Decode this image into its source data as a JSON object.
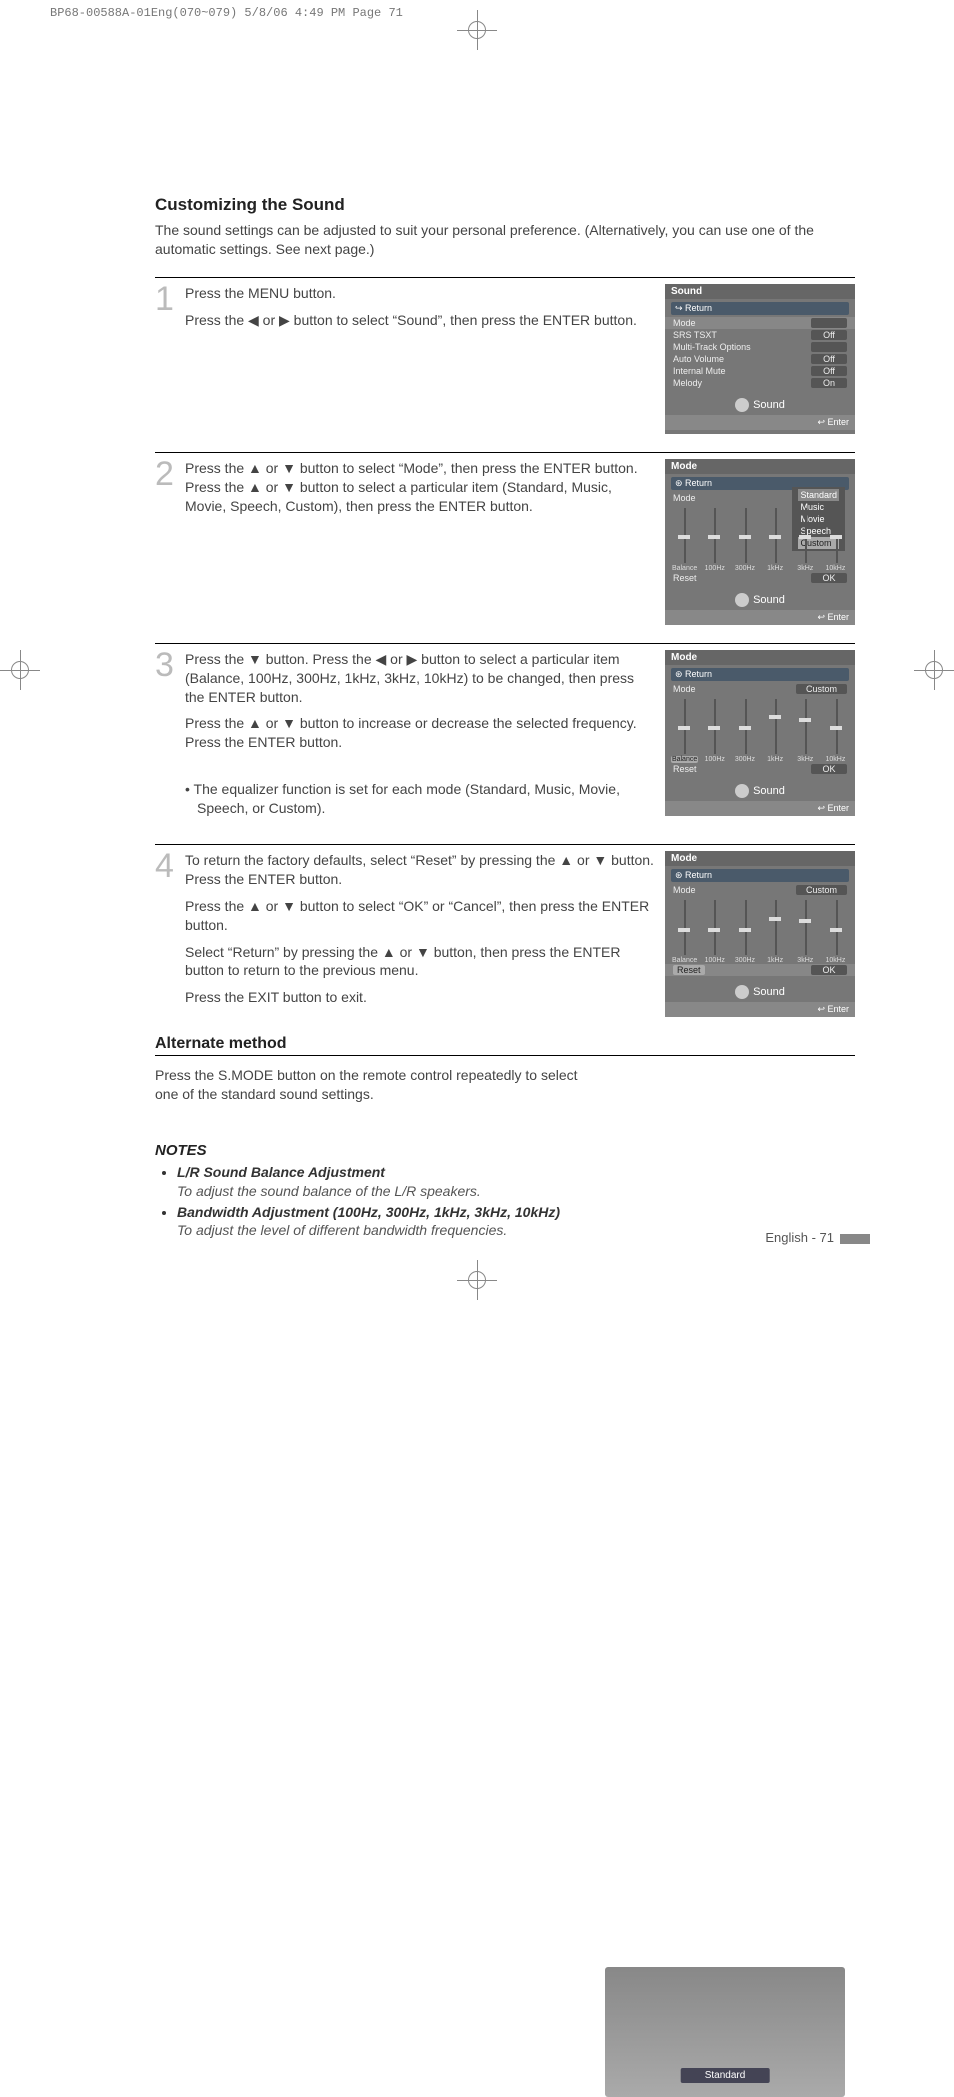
{
  "crop_header": "BP68-00588A-01Eng(070~079)  5/8/06  4:49 PM  Page 71",
  "title": "Customizing the Sound",
  "intro": "The sound settings can be adjusted to suit your personal preference. (Alternatively, you can use one of the automatic settings. See next page.)",
  "steps": [
    {
      "num": "1",
      "paras": [
        "Press the MENU button.",
        "Press the ◀ or ▶ button to select “Sound”, then press the ENTER button."
      ],
      "bullet": ""
    },
    {
      "num": "2",
      "paras": [
        "Press the ▲ or ▼ button to select “Mode”, then press the ENTER button. Press the ▲ or ▼ button to select a particular item (Standard, Music, Movie, Speech, Custom), then press the ENTER button."
      ],
      "bullet": ""
    },
    {
      "num": "3",
      "paras": [
        "Press the ▼ button. Press the ◀ or ▶ button to select a particular item (Balance, 100Hz, 300Hz, 1kHz, 3kHz, 10kHz) to be changed, then press the ENTER button.",
        "Press the ▲ or ▼ button to increase or decrease the selected frequency. Press the ENTER button."
      ],
      "bullet": "• The equalizer function is set for each mode (Standard, Music, Movie, Speech, or Custom)."
    },
    {
      "num": "4",
      "paras": [
        "To return the factory defaults, select “Reset” by pressing the ▲ or ▼ button. Press the ENTER button.",
        "Press the ▲ or ▼ button to select “OK” or “Cancel”, then press the ENTER button.",
        "Select “Return” by pressing the ▲ or ▼ button, then press the ENTER button to return to the previous menu.",
        "Press the EXIT button to exit."
      ],
      "bullet": ""
    }
  ],
  "screenshot1": {
    "title": "Sound",
    "return": "↪ Return",
    "rows": [
      {
        "label": "Mode",
        "val": ""
      },
      {
        "label": "SRS TSXT",
        "val": "Off"
      },
      {
        "label": "Multi-Track Options",
        "val": ""
      },
      {
        "label": "Auto Volume",
        "val": "Off"
      },
      {
        "label": "Internal Mute",
        "val": "Off"
      },
      {
        "label": "Melody",
        "val": "On"
      }
    ],
    "footer_label": "Sound",
    "footer_enter": "↩ Enter"
  },
  "screenshot2": {
    "title": "Mode",
    "return": "⊛ Return",
    "mode_label": "Mode",
    "dropdown": [
      "Standard",
      "Music",
      "Movie",
      "Speech",
      "Custom"
    ],
    "eq_labels": [
      "Balance",
      "100Hz",
      "300Hz",
      "1kHz",
      "3kHz",
      "10kHz"
    ],
    "reset": "Reset",
    "ok": "OK",
    "footer_label": "Sound",
    "footer_enter": "↩ Enter"
  },
  "screenshot3": {
    "title": "Mode",
    "return": "⊛ Return",
    "mode_label": "Mode",
    "mode_value": "Custom",
    "eq_labels": [
      "Balance",
      "100Hz",
      "300Hz",
      "1kHz",
      "3kHz",
      "10kHz"
    ],
    "eq_hl": "Balance",
    "reset": "Reset",
    "ok": "OK",
    "footer_label": "Sound",
    "footer_enter": "↩ Enter"
  },
  "screenshot4": {
    "title": "Mode",
    "return": "⊛ Return",
    "mode_label": "Mode",
    "mode_value": "Custom",
    "eq_labels": [
      "Balance",
      "100Hz",
      "300Hz",
      "1kHz",
      "3kHz",
      "10kHz"
    ],
    "reset": "Reset",
    "reset_hl": true,
    "ok": "OK",
    "footer_label": "Sound",
    "footer_enter": "↩ Enter"
  },
  "alt_title": "Alternate method",
  "alt_text": "Press the S.MODE button on the remote control repeatedly to select one of the standard sound settings.",
  "remote_badge": "Standard",
  "notes_title": "NOTES",
  "notes": [
    {
      "title": "L/R Sound Balance Adjustment",
      "desc": "To adjust the sound balance of the L/R speakers."
    },
    {
      "title": "Bandwidth Adjustment (100Hz, 300Hz, 1kHz, 3kHz, 10kHz)",
      "desc": "To adjust the level of different bandwidth frequencies."
    }
  ],
  "page_footer": "English - 71"
}
